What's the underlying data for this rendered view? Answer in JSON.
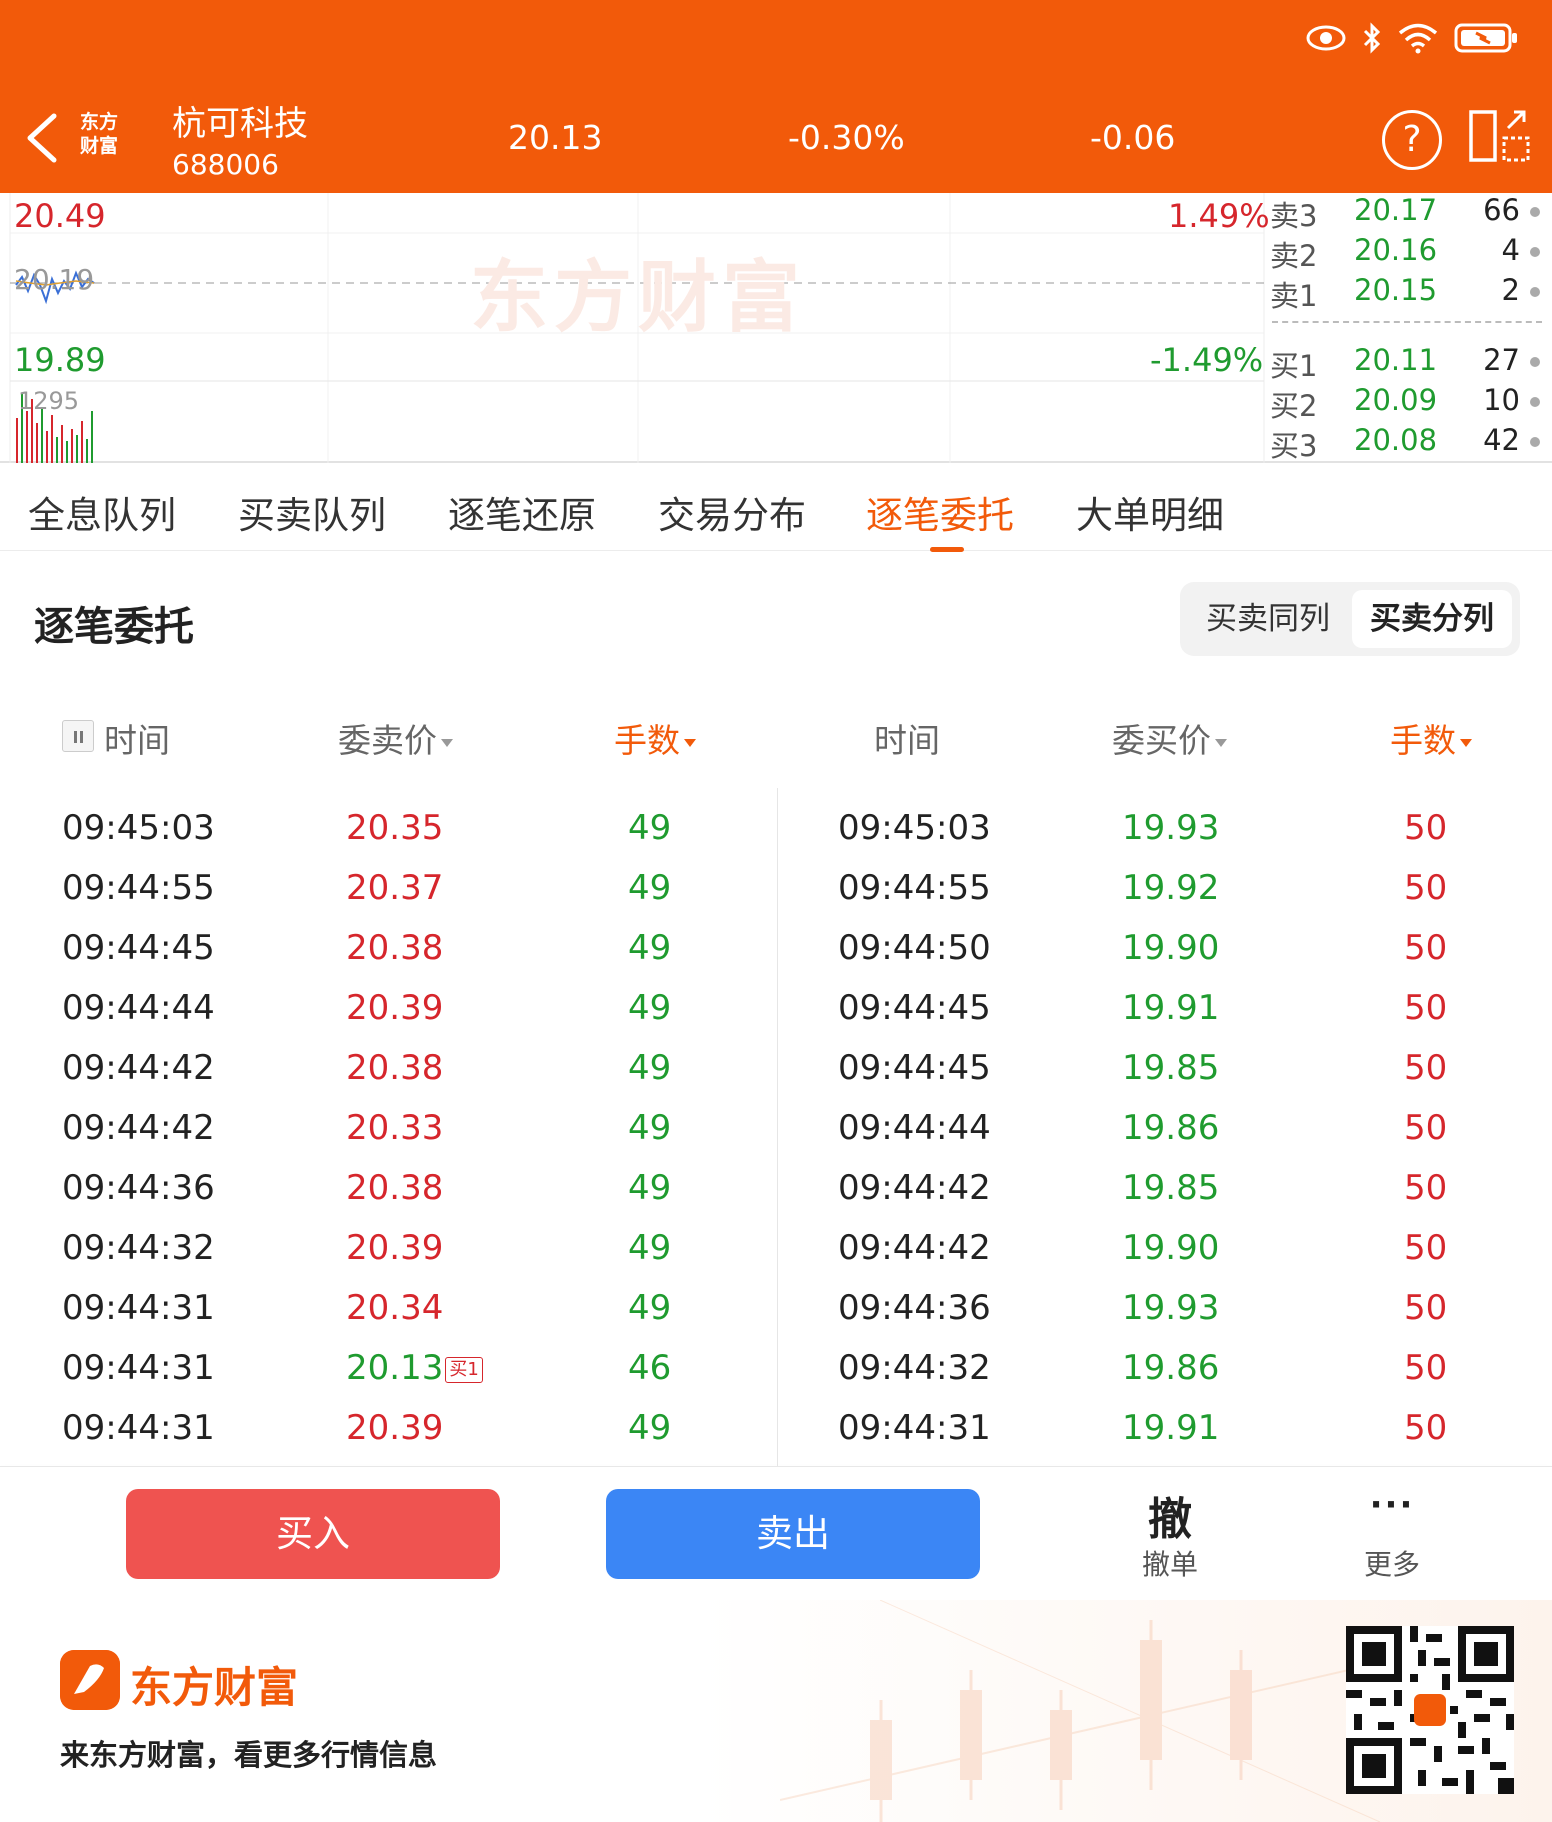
{
  "header": {
    "stock_name": "杭可科技",
    "stock_code": "688006",
    "price": "20.13",
    "change_pct": "-0.30%",
    "change": "-0.06",
    "help_glyph": "?"
  },
  "chart": {
    "high_price": "20.49",
    "high_pct": "1.49%",
    "mid_price": "20.19",
    "low_price": "19.89",
    "low_pct": "-1.49%",
    "volume_label": "1295",
    "watermark": "东方财富",
    "sell_orders": [
      {
        "label": "卖3",
        "price": "20.17",
        "volume": "66"
      },
      {
        "label": "卖2",
        "price": "20.16",
        "volume": "4"
      },
      {
        "label": "卖1",
        "price": "20.15",
        "volume": "2"
      }
    ],
    "buy_orders": [
      {
        "label": "买1",
        "price": "20.11",
        "volume": "27"
      },
      {
        "label": "买2",
        "price": "20.09",
        "volume": "10"
      },
      {
        "label": "买3",
        "price": "20.08",
        "volume": "42"
      }
    ]
  },
  "tabs": [
    "全息队列",
    "买卖队列",
    "逐笔还原",
    "交易分布",
    "逐笔委托",
    "大单明细"
  ],
  "active_tab": "逐笔委托",
  "section": {
    "title": "逐笔委托",
    "toggle_same": "买卖同列",
    "toggle_split": "买卖分列"
  },
  "columns": {
    "sell_time": "时间",
    "sell_price": "委卖价",
    "sell_qty": "手数",
    "buy_time": "时间",
    "buy_price": "委买价",
    "buy_qty": "手数"
  },
  "rows": [
    {
      "sell_time": "09:45:03",
      "sell_price": "20.35",
      "sell_qty": "49",
      "buy_time": "09:45:03",
      "buy_price": "19.93",
      "buy_qty": "50"
    },
    {
      "sell_time": "09:44:55",
      "sell_price": "20.37",
      "sell_qty": "49",
      "buy_time": "09:44:55",
      "buy_price": "19.92",
      "buy_qty": "50"
    },
    {
      "sell_time": "09:44:45",
      "sell_price": "20.38",
      "sell_qty": "49",
      "buy_time": "09:44:50",
      "buy_price": "19.90",
      "buy_qty": "50"
    },
    {
      "sell_time": "09:44:44",
      "sell_price": "20.39",
      "sell_qty": "49",
      "buy_time": "09:44:45",
      "buy_price": "19.91",
      "buy_qty": "50"
    },
    {
      "sell_time": "09:44:42",
      "sell_price": "20.38",
      "sell_qty": "49",
      "buy_time": "09:44:45",
      "buy_price": "19.85",
      "buy_qty": "50"
    },
    {
      "sell_time": "09:44:42",
      "sell_price": "20.33",
      "sell_qty": "49",
      "buy_time": "09:44:44",
      "buy_price": "19.86",
      "buy_qty": "50"
    },
    {
      "sell_time": "09:44:36",
      "sell_price": "20.38",
      "sell_qty": "49",
      "buy_time": "09:44:42",
      "buy_price": "19.85",
      "buy_qty": "50"
    },
    {
      "sell_time": "09:44:32",
      "sell_price": "20.39",
      "sell_qty": "49",
      "buy_time": "09:44:42",
      "buy_price": "19.90",
      "buy_qty": "50"
    },
    {
      "sell_time": "09:44:31",
      "sell_price": "20.34",
      "sell_qty": "49",
      "buy_time": "09:44:36",
      "buy_price": "19.93",
      "buy_qty": "50"
    },
    {
      "sell_time": "09:44:31",
      "sell_price": "20.13",
      "sell_tag": "买1",
      "sell_qty": "46",
      "buy_time": "09:44:32",
      "buy_price": "19.86",
      "buy_qty": "50"
    },
    {
      "sell_time": "09:44:31",
      "sell_price": "20.39",
      "sell_qty": "49",
      "buy_time": "09:44:31",
      "buy_price": "19.91",
      "buy_qty": "50"
    }
  ],
  "actions": {
    "buy": "买入",
    "sell": "卖出",
    "cancel_glyph": "撤",
    "cancel_label": "撤单",
    "more_glyph": "···",
    "more_label": "更多"
  },
  "footer": {
    "brand": "东方财富",
    "slogan": "来东方财富，看更多行情信息"
  },
  "colors": {
    "brand_orange": "#f25a0a",
    "up_red": "#d6262c",
    "down_green": "#1f9b2f",
    "buy_button": "#ef5350",
    "sell_button": "#3b86f5"
  }
}
